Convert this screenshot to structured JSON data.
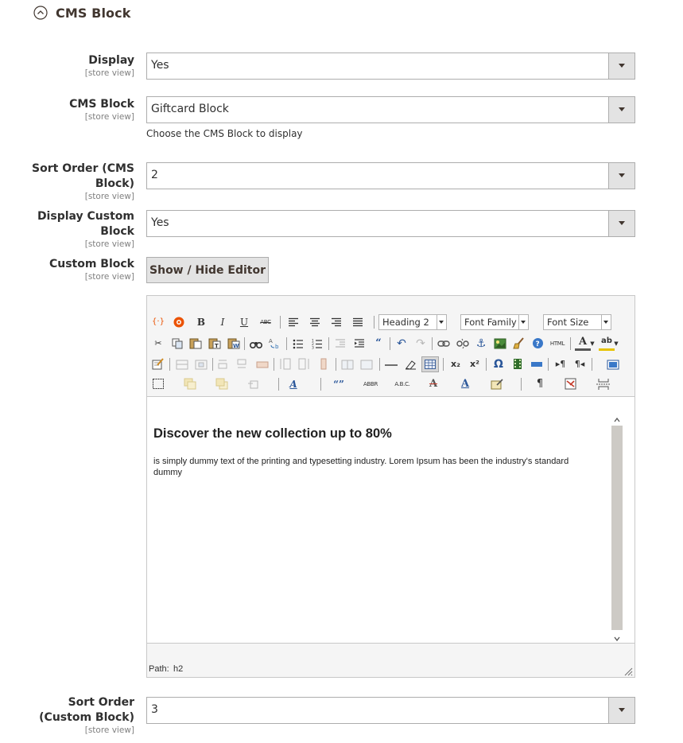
{
  "section": {
    "title": "CMS Block",
    "icon": "collapse-circle-icon"
  },
  "fields": {
    "display": {
      "label": "Display",
      "scope": "[store view]",
      "value": "Yes"
    },
    "cms_block": {
      "label": "CMS Block",
      "scope": "[store view]",
      "value": "Giftcard Block",
      "note": "Choose the CMS Block to display"
    },
    "sort_order_cms": {
      "label_line1": "Sort Order (CMS",
      "label_line2": "Block)",
      "scope": "[store view]",
      "value": "2"
    },
    "display_custom": {
      "label_line1": "Display Custom",
      "label_line2": "Block",
      "scope": "[store view]",
      "value": "Yes"
    },
    "custom_block": {
      "label": "Custom Block",
      "scope": "[store view]",
      "button_label": "Show / Hide Editor"
    },
    "sort_order_custom": {
      "label_line1": "Sort Order",
      "label_line2": "(Custom Block)",
      "scope": "[store view]",
      "value": "3"
    }
  },
  "editor": {
    "format_dropdown": "Heading 2",
    "font_family_dropdown": "Font Family",
    "font_size_dropdown": "Font Size",
    "toolbar_text": {
      "bold": "B",
      "italic": "I",
      "underline": "U",
      "strikethrough": "ABC",
      "html": "HTML",
      "quote": "“”",
      "abbr": "ABBR",
      "acronym": "A.B.C.",
      "omega": "Ω",
      "pilcrow": "¶",
      "widget": "{·}"
    },
    "content": {
      "heading": "Discover the new collection up to 80%",
      "paragraph": "is simply dummy text of the printing and typesetting industry. Lorem Ipsum has been the industry's standard dummy"
    },
    "status": {
      "path_label": "Path:",
      "path_value": "h2"
    }
  },
  "colors": {
    "accent_icon": "#eb5202",
    "select_button_bg": "#e3e3e3",
    "border": "#adadad",
    "scroll_track": "#cdcac5"
  }
}
